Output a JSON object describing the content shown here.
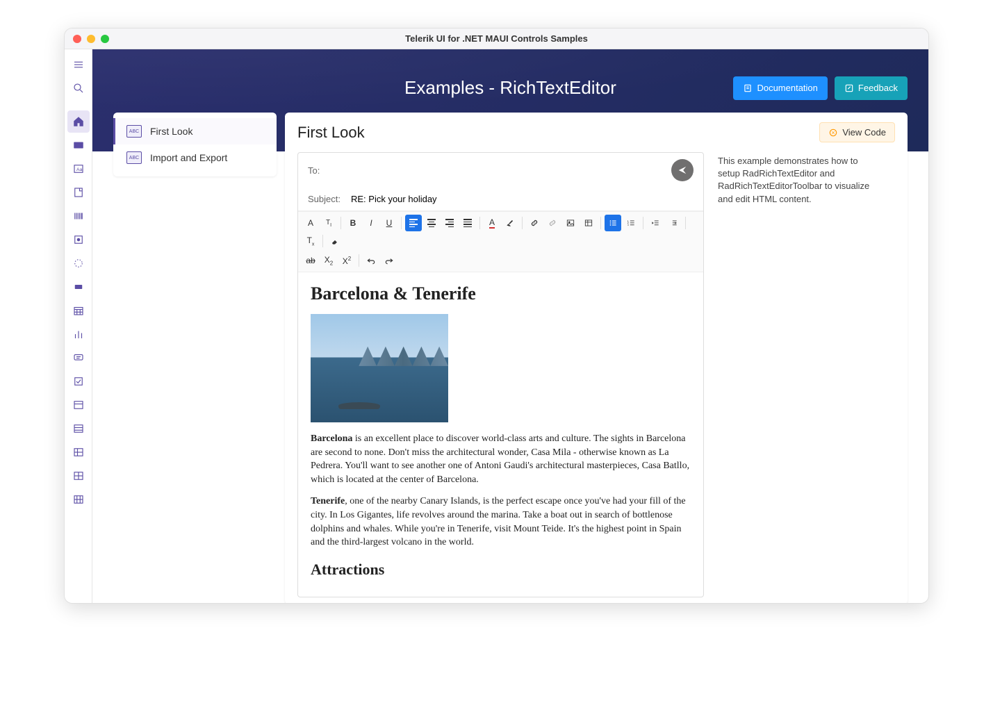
{
  "window": {
    "title": "Telerik UI for .NET MAUI Controls Samples"
  },
  "leftRail": {
    "icons": [
      "menu",
      "search",
      "home",
      "card",
      "text",
      "note",
      "barcode",
      "expand",
      "loader",
      "label",
      "calendar",
      "chart",
      "chat",
      "check",
      "panel",
      "panel2",
      "table",
      "grid",
      "grid2"
    ]
  },
  "header": {
    "title": "Examples - RichTextEditor",
    "documentation": "Documentation",
    "feedback": "Feedback"
  },
  "sidebar": {
    "items": [
      {
        "label": "First Look",
        "active": true
      },
      {
        "label": "Import and Export",
        "active": false
      }
    ]
  },
  "main": {
    "title": "First Look",
    "viewCode": "View Code",
    "email": {
      "to_label": "To:",
      "to_value": "",
      "subject_label": "Subject:",
      "subject_value": "RE: Pick your holiday"
    },
    "toolbar": {
      "row1": [
        "font-family",
        "font-size",
        "|",
        "bold",
        "italic",
        "underline",
        "|",
        "align-left",
        "align-center",
        "align-right",
        "align-justify",
        "|",
        "font-color",
        "highlight",
        "|",
        "link",
        "unlink",
        "image",
        "table",
        "|",
        "bullet-list",
        "number-list",
        "|",
        "outdent",
        "indent",
        "|",
        "clear-format",
        "|",
        "eraser"
      ],
      "row2": [
        "strikethrough",
        "subscript",
        "superscript",
        "|",
        "undo",
        "redo"
      ],
      "active": [
        "align-left",
        "bullet-list"
      ]
    },
    "content": {
      "h1": "Barcelona & Tenerife",
      "p1_bold": "Barcelona",
      "p1_rest": " is an excellent place to discover world-class arts and culture. The sights in Barcelona are second to none. Don't miss the architectural wonder, Casa Mila - otherwise known as La Pedrera. You'll want to see another one of Antoni Gaudi's architectural masterpieces, Casa Batllo, which is located at the center of Barcelona.",
      "p2_bold": "Tenerife",
      "p2_rest": ", one of the nearby Canary Islands, is the perfect escape once you've had your fill of the city. In Los Gigantes, life revolves around the marina. Take a boat out in search of bottlenose dolphins and whales. While you're in Tenerife, visit Mount Teide. It's the highest point in Spain and the third-largest volcano in the world.",
      "h2": "Attractions"
    },
    "description": "This example demonstrates how to setup RadRichTextEditor and RadRichTextEditorToolbar to visualize and edit HTML content."
  }
}
